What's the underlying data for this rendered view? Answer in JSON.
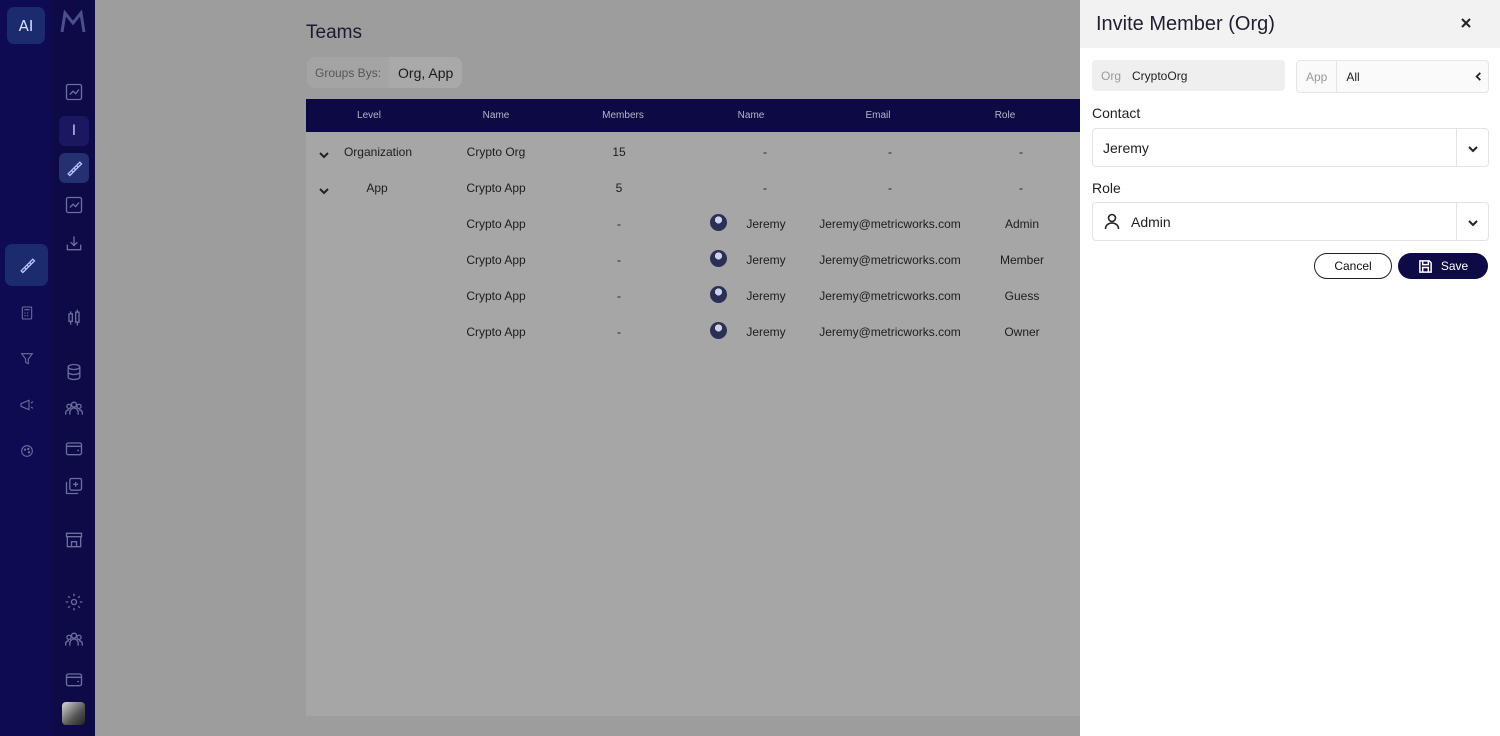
{
  "sidebar": {
    "ai_label": "AI",
    "letter_item": "I",
    "icons": [
      "trend-icon",
      "letter-box",
      "pencil-ruler-icon",
      "trend-icon",
      "download-icon",
      "candles-icon",
      "database-icon",
      "team-icon",
      "wallet-icon",
      "add-copy-icon",
      "store-icon",
      "gear-icon",
      "team-icon",
      "wallet-icon",
      "profile-avatar"
    ]
  },
  "page": {
    "title": "Teams",
    "group_by_label": "Groups Bys:",
    "group_by_value": "Org, App"
  },
  "table": {
    "headers": [
      "Level",
      "Name",
      "Members",
      "Name",
      "Email",
      "Role"
    ],
    "rows": [
      {
        "level": "Organization",
        "name": "Crypto Org",
        "members": "15",
        "member_name": "-",
        "email": "-",
        "role": "-",
        "expandable": true
      },
      {
        "level": "App",
        "name": "Crypto App",
        "members": "5",
        "member_name": "-",
        "email": "-",
        "role": "-",
        "expandable": true
      },
      {
        "level": "",
        "name": "Crypto App",
        "members": "-",
        "member_name": "Jeremy",
        "email": "Jeremy@metricworks.com",
        "role": "Admin",
        "expandable": false
      },
      {
        "level": "",
        "name": "Crypto App",
        "members": "-",
        "member_name": "Jeremy",
        "email": "Jeremy@metricworks.com",
        "role": "Member",
        "expandable": false
      },
      {
        "level": "",
        "name": "Crypto App",
        "members": "-",
        "member_name": "Jeremy",
        "email": "Jeremy@metricworks.com",
        "role": "Guess",
        "expandable": false
      },
      {
        "level": "",
        "name": "Crypto App",
        "members": "-",
        "member_name": "Jeremy",
        "email": "Jeremy@metricworks.com",
        "role": "Owner",
        "expandable": false
      }
    ]
  },
  "drawer": {
    "title": "Invite Member (Org)",
    "org_label": "Org",
    "org_value": "CryptoOrg",
    "app_label": "App",
    "app_value": "All",
    "contact_label": "Contact",
    "contact_value": "Jeremy",
    "role_label": "Role",
    "role_value": "Admin",
    "cancel_label": "Cancel",
    "save_label": "Save"
  },
  "colors": {
    "sidebar_bg": "#0f0b52",
    "table_header_bg": "#0c0944",
    "primary_button": "#0d0a45",
    "overlay": "#9d9d9d"
  }
}
